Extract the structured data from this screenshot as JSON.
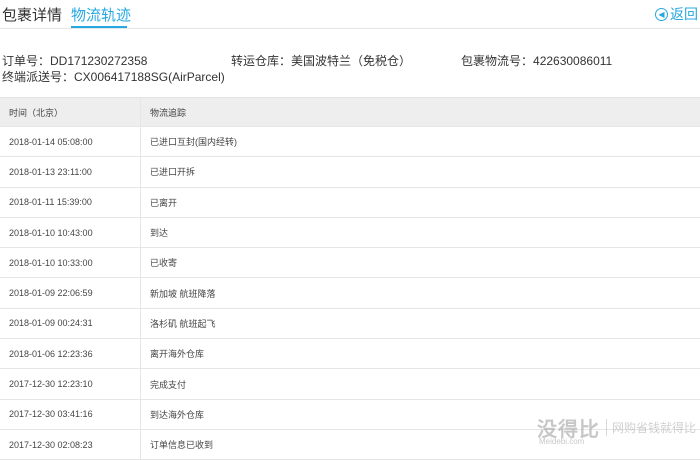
{
  "tabs": {
    "details": "包裹详情",
    "tracking": "物流轨迹"
  },
  "back": {
    "icon": "back-arrow-icon",
    "label": "返回"
  },
  "info": {
    "order_label": "订单号：",
    "order_value": "DD171230272358",
    "warehouse_label": "转运仓库：",
    "warehouse_value": "美国波特兰（免税仓）",
    "package_label": "包裹物流号：",
    "package_value": "422630086011",
    "delivery_label": "终端派送号：",
    "delivery_value": "CX006417188SG(AirParcel)"
  },
  "table": {
    "headers": [
      "时间（北京）",
      "物流追踪"
    ],
    "rows": [
      [
        "2018-01-14 05:08:00",
        "已进口互封(国内经转)"
      ],
      [
        "2018-01-13 23:11:00",
        "已进口开拆"
      ],
      [
        "2018-01-11 15:39:00",
        "已离开"
      ],
      [
        "2018-01-10 10:43:00",
        "到达"
      ],
      [
        "2018-01-10 10:33:00",
        "已收寄"
      ],
      [
        "2018-01-09 22:06:59",
        "新加坡 航班降落"
      ],
      [
        "2018-01-09 00:24:31",
        "洛杉矶 航班起飞"
      ],
      [
        "2018-01-06 12:23:36",
        "离开海外仓库"
      ],
      [
        "2017-12-30 12:23:10",
        "完成支付"
      ],
      [
        "2017-12-30 03:41:16",
        "到达海外仓库"
      ],
      [
        "2017-12-30 02:08:23",
        "订单信息已收到"
      ]
    ]
  },
  "watermark": {
    "logo": "没得比",
    "sub": "Meidebi.com",
    "slogan": "网购省钱就得比"
  },
  "colors": {
    "accent": "#27a8e0",
    "header_bg": "#eeeeee"
  }
}
